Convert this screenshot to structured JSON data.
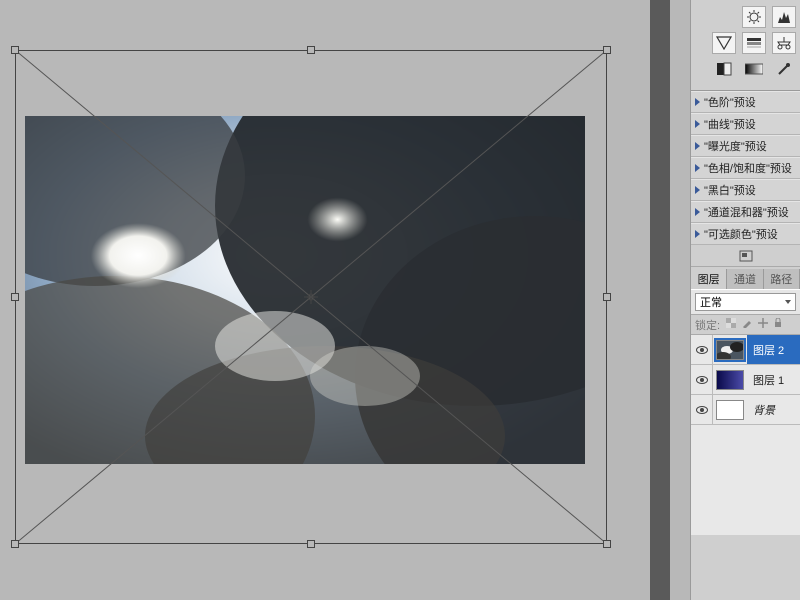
{
  "presets": {
    "items": [
      {
        "label": "\"色阶\"预设"
      },
      {
        "label": "\"曲线\"预设"
      },
      {
        "label": "\"曝光度\"预设"
      },
      {
        "label": "\"色相/饱和度\"预设"
      },
      {
        "label": "\"黑白\"预设"
      },
      {
        "label": "\"通道混和器\"预设"
      },
      {
        "label": "\"可选颜色\"预设"
      }
    ]
  },
  "tabs": {
    "layers": "图层",
    "channels": "通道",
    "paths": "路径"
  },
  "blend": {
    "mode": "正常"
  },
  "lock": {
    "label": "锁定:"
  },
  "layers": {
    "items": [
      {
        "name": "图层 2",
        "thumb": "clouds",
        "selected": true
      },
      {
        "name": "图层 1",
        "thumb": "gradient",
        "selected": false
      },
      {
        "name": "背景",
        "thumb": "white",
        "selected": false,
        "italic": true
      }
    ]
  }
}
